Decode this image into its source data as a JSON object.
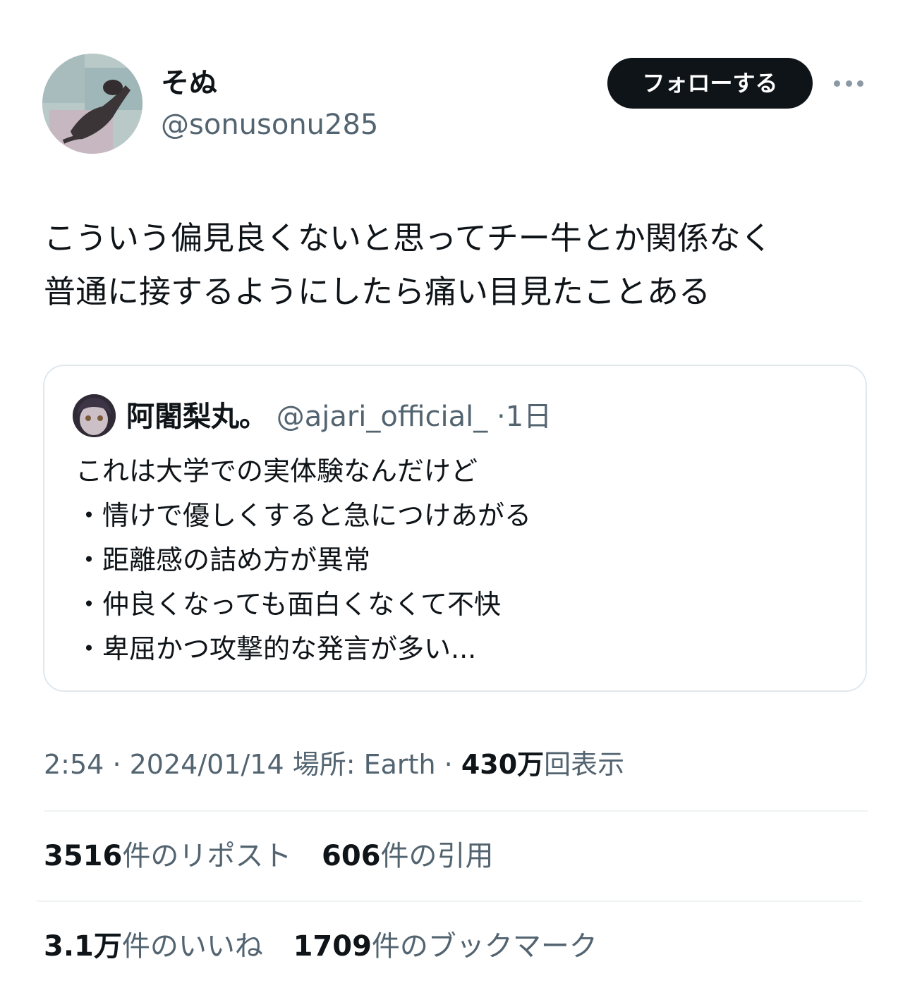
{
  "author": {
    "display_name": "そぬ",
    "handle": "@sonusonu285",
    "follow_label": "フォローする"
  },
  "tweet": {
    "lines": [
      "こういう偏見良くないと思ってチー牛とか関係なく",
      "普通に接するようにしたら痛い目見たことある"
    ]
  },
  "quote": {
    "name": "阿闍梨丸。",
    "handle": "@ajari_official_",
    "separator": "·",
    "time": "1日",
    "lines": [
      "これは大学での実体験なんだけど",
      "・情けで優しくすると急につけあがる",
      "・距離感の詰め方が異常",
      "・仲良くなっても面白くなくて不快",
      "・卑屈かつ攻撃的な発言が多い..."
    ]
  },
  "meta": {
    "time": "2:54",
    "dot1": "·",
    "date": "2024/01/14",
    "location": "場所: Earth",
    "dot2": "·",
    "views_count": "430万",
    "views_label": "回表示"
  },
  "stats": {
    "reposts_count": "3516",
    "reposts_label": "件のリポスト",
    "quotes_count": "606",
    "quotes_label": "件の引用",
    "likes_count": "3.1万",
    "likes_label": "件のいいね",
    "bookmarks_count": "1709",
    "bookmarks_label": "件のブックマーク"
  },
  "colors": {
    "text": "#0f1419",
    "secondary": "#536471",
    "button_bg": "#0f1419",
    "border": "#e1e8ed"
  },
  "icons": {
    "author_avatar": "cat-photo-avatar",
    "quote_avatar": "anime-girl-avatar",
    "more": "more-horizontal-icon"
  }
}
